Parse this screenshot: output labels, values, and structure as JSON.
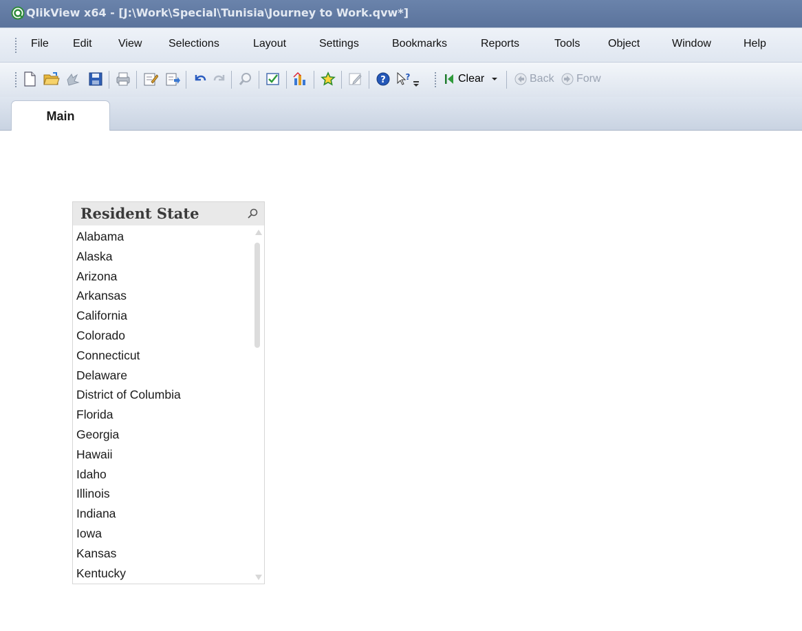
{
  "window": {
    "title": "QlikView x64 - [J:\\Work\\Special\\Tunisia\\Journey to Work.qvw*]"
  },
  "menu": {
    "items": [
      "File",
      "Edit",
      "View",
      "Selections",
      "Layout",
      "Settings",
      "Bookmarks",
      "Reports",
      "Tools",
      "Object",
      "Window",
      "Help"
    ]
  },
  "toolbar": {
    "clear_label": "Clear",
    "back_label": "Back",
    "forward_label": "Forw",
    "icons": [
      "new-document-icon",
      "open-folder-icon",
      "reload-icon",
      "save-icon",
      "print-icon",
      "edit-script-icon",
      "reload-data-icon",
      "undo-icon",
      "redo-icon",
      "search-icon",
      "select-fields-icon",
      "new-chart-icon",
      "bookmark-star-icon",
      "edit-object-icon",
      "help-icon",
      "context-help-icon"
    ]
  },
  "tabs": [
    {
      "label": "Main"
    }
  ],
  "listbox": {
    "title": "Resident State",
    "items": [
      "Alabama",
      "Alaska",
      "Arizona",
      "Arkansas",
      "California",
      "Colorado",
      "Connecticut",
      "Delaware",
      "District of Columbia",
      "Florida",
      "Georgia",
      "Hawaii",
      "Idaho",
      "Illinois",
      "Indiana",
      "Iowa",
      "Kansas",
      "Kentucky"
    ]
  },
  "colors": {
    "background": "#4f6790",
    "title_bar": "#6a83ab",
    "sheet": "#ffffff",
    "listbox_header": "#e9e9e9"
  }
}
